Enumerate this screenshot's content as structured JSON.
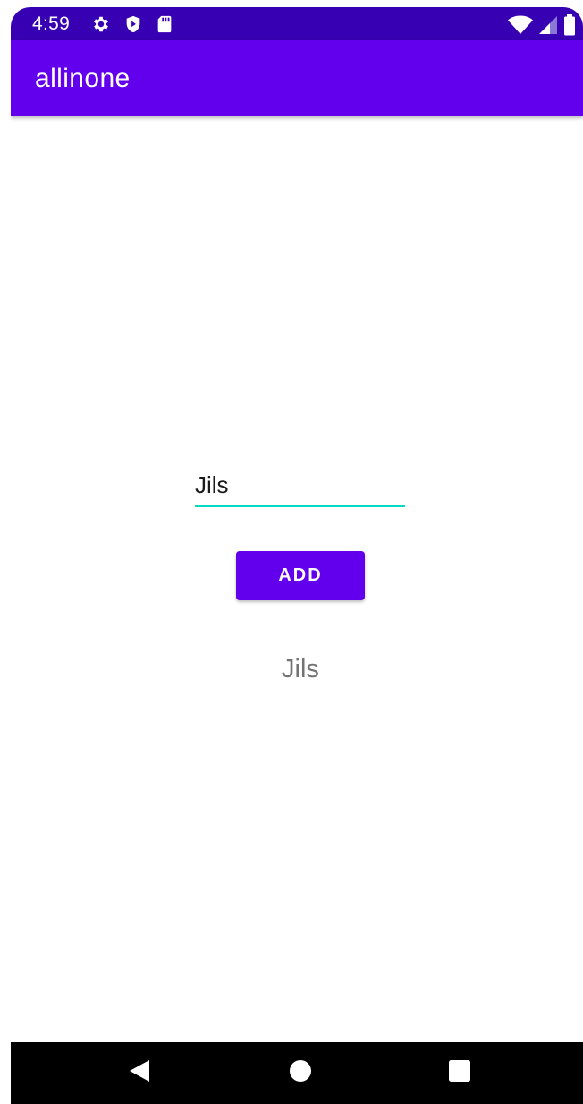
{
  "status_bar": {
    "time": "4:59",
    "left_icons": [
      "gear-icon",
      "shield-play-icon",
      "sd-card-icon"
    ],
    "right_icons": [
      "wifi-icon",
      "signal-icon",
      "battery-icon"
    ]
  },
  "app_bar": {
    "title": "allinone"
  },
  "form": {
    "input_value": "Jils",
    "input_placeholder": "",
    "add_label": "ADD"
  },
  "result": {
    "text": "Jils"
  },
  "nav_bar": {
    "buttons": [
      "back-icon",
      "home-icon",
      "recents-icon"
    ]
  },
  "colors": {
    "status_bar": "#3700b3",
    "primary": "#6200ee",
    "accent": "#03dac5",
    "result_text": "#737373"
  }
}
